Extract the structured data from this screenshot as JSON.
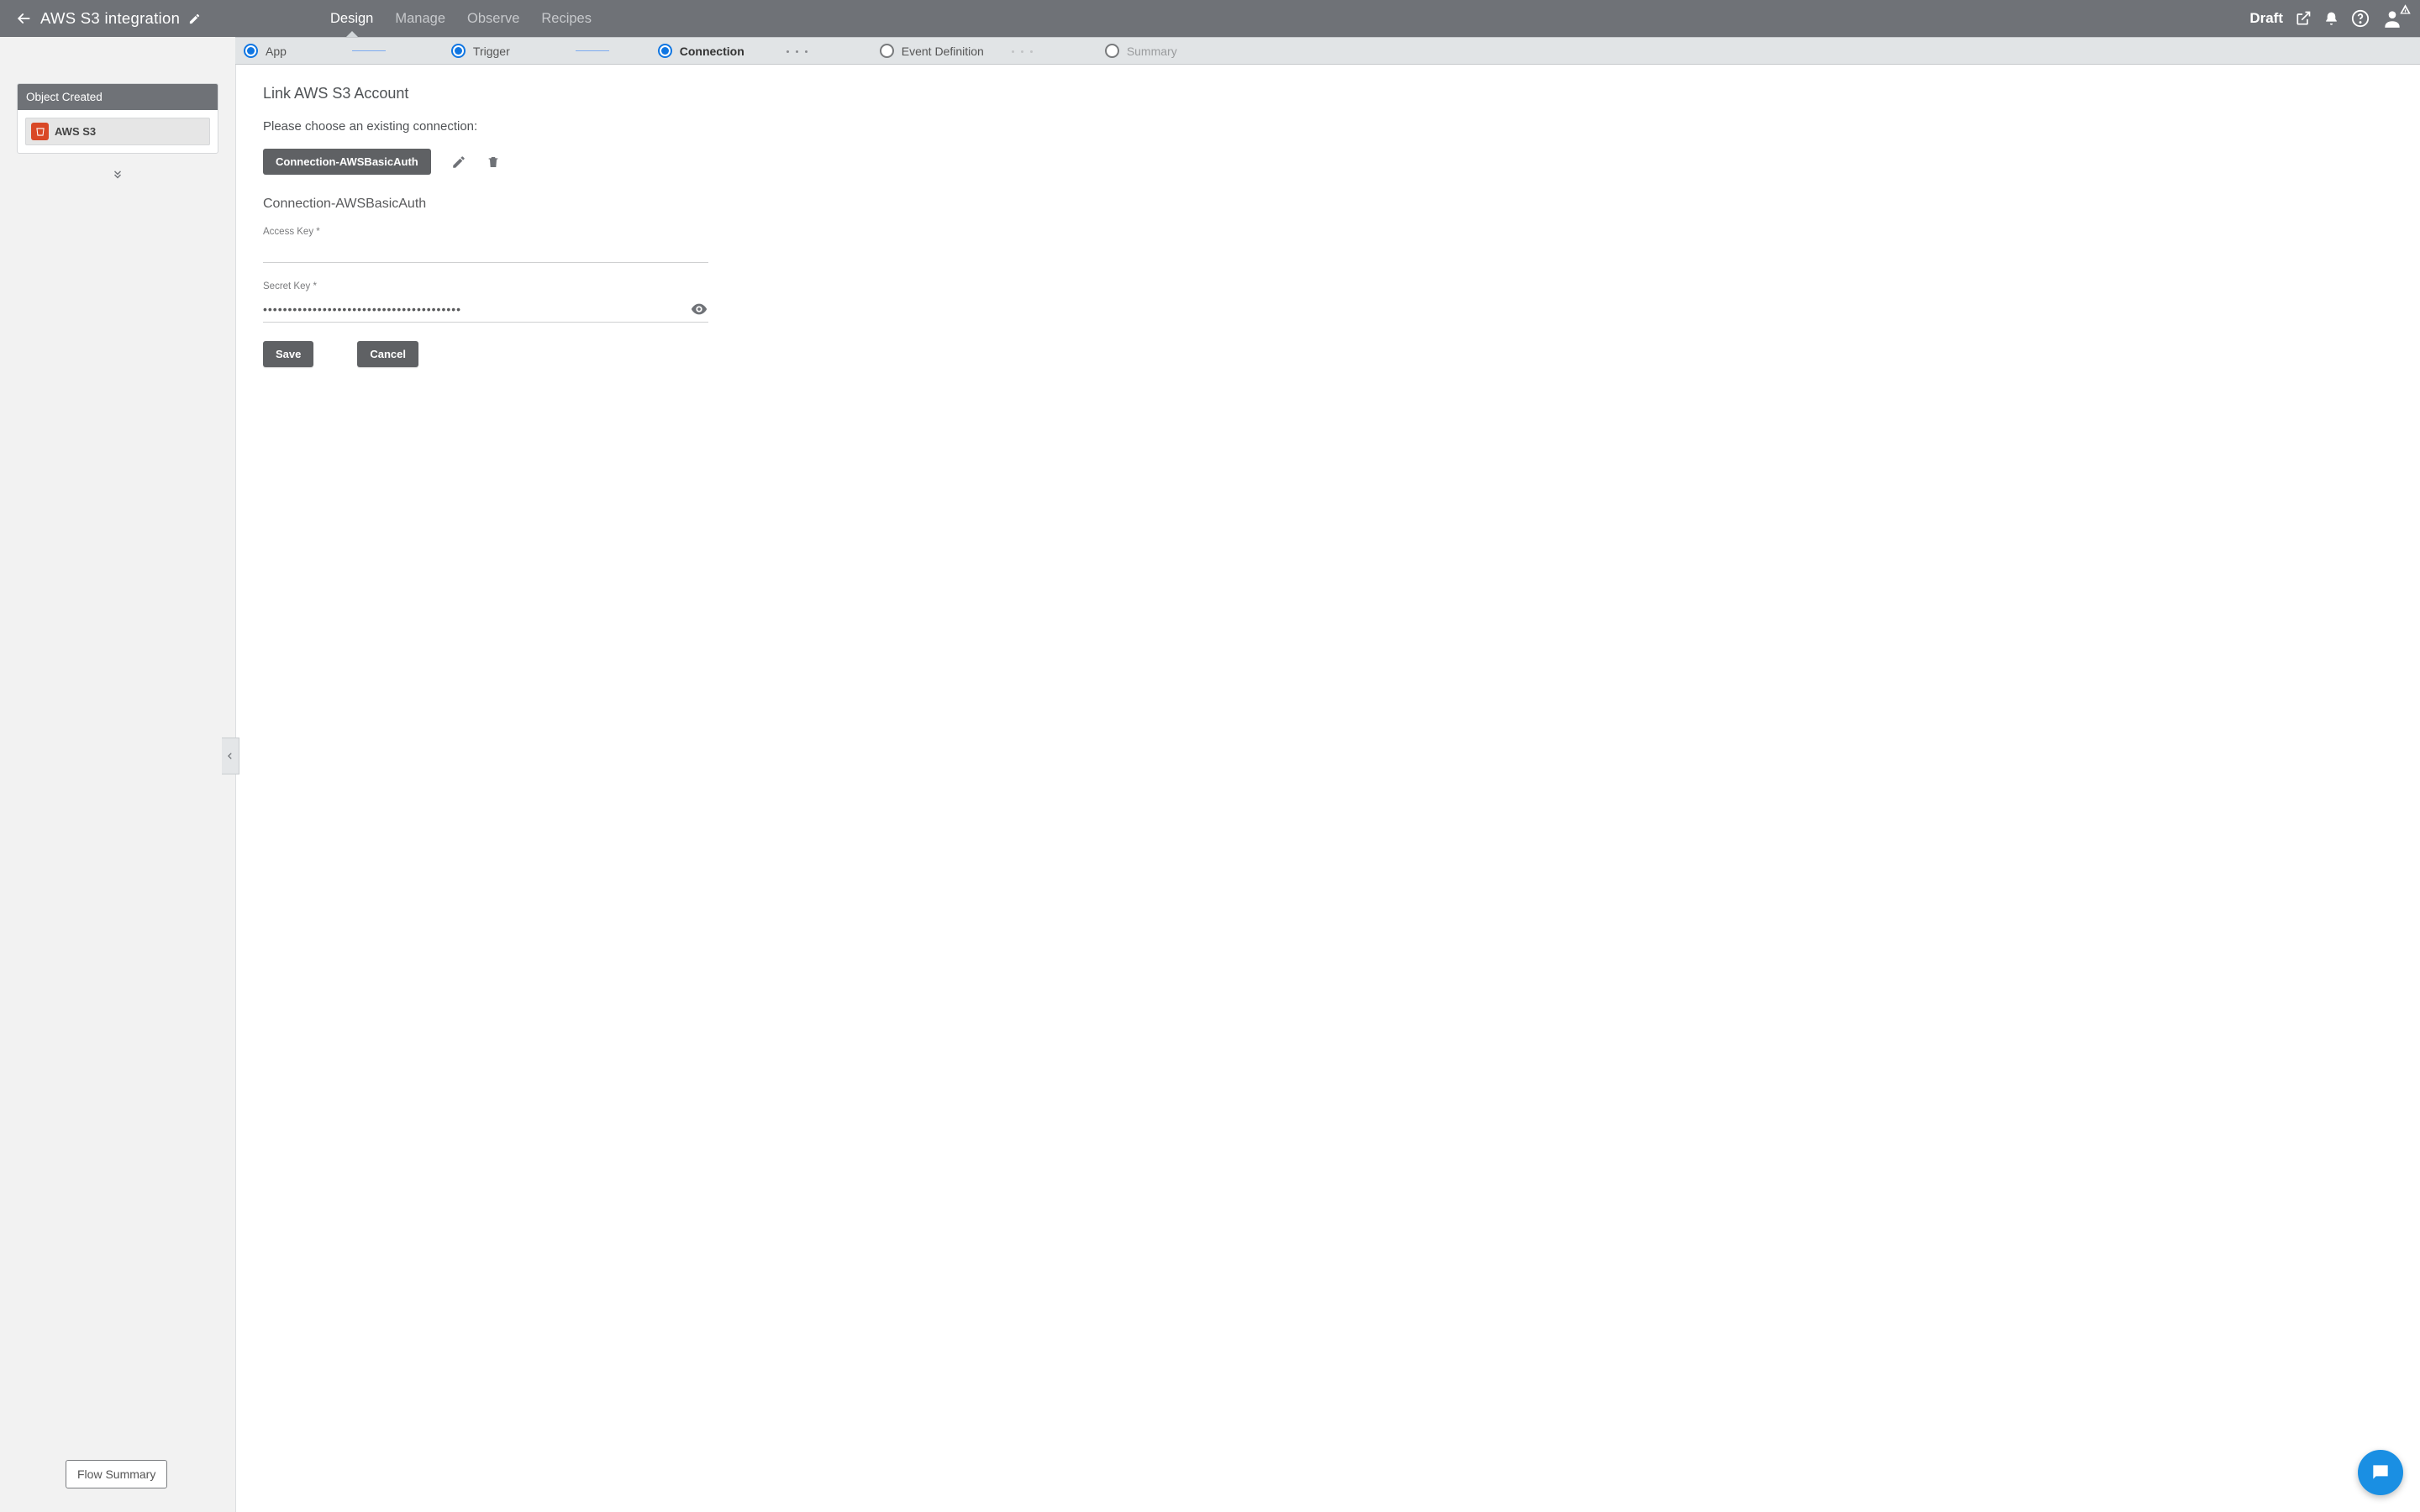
{
  "topbar": {
    "title": "AWS S3 integration",
    "tabs": [
      {
        "label": "Design",
        "active": true
      },
      {
        "label": "Manage",
        "active": false
      },
      {
        "label": "Observe",
        "active": false
      },
      {
        "label": "Recipes",
        "active": false
      }
    ],
    "status": "Draft"
  },
  "stepper": {
    "steps": [
      {
        "label": "App",
        "state": "done"
      },
      {
        "label": "Trigger",
        "state": "done"
      },
      {
        "label": "Connection",
        "state": "active"
      },
      {
        "label": "Event Definition",
        "state": "future"
      },
      {
        "label": "Summary",
        "state": "future"
      }
    ]
  },
  "sidebar": {
    "card_title": "Object Created",
    "item_label": "AWS S3",
    "flow_summary": "Flow Summary"
  },
  "form": {
    "heading": "Link AWS S3 Account",
    "prompt": "Please choose an existing connection:",
    "connection_chip": "Connection-AWSBasicAuth",
    "connection_name": "Connection-AWSBasicAuth",
    "access_key_label": "Access Key *",
    "access_key_value": "",
    "secret_key_label": "Secret Key *",
    "secret_key_value": "••••••••••••••••••••••••••••••••••••••••",
    "save": "Save",
    "cancel": "Cancel"
  }
}
